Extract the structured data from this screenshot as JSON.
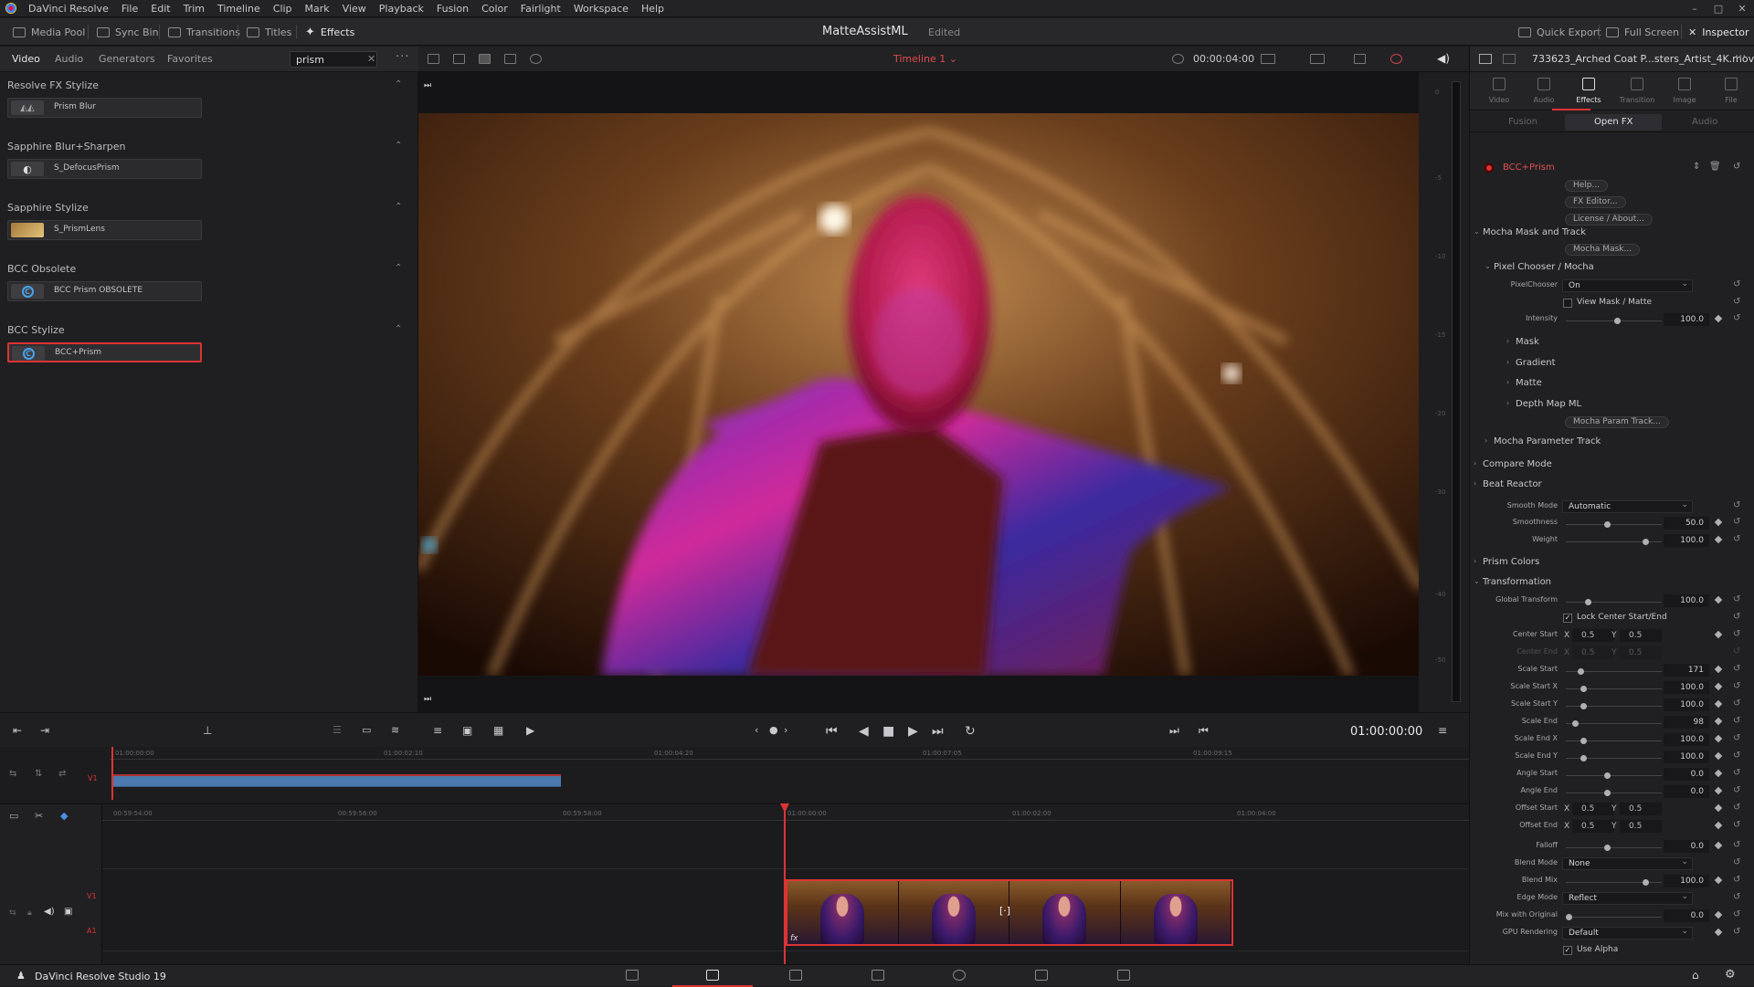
{
  "app": {
    "menu": [
      "DaVinci Resolve",
      "File",
      "Edit",
      "Trim",
      "Timeline",
      "Clip",
      "Mark",
      "View",
      "Playback",
      "Fusion",
      "Color",
      "Fairlight",
      "Workspace",
      "Help"
    ],
    "window_controls": [
      "–",
      "□",
      "✕"
    ],
    "status_name": "DaVinci Resolve Studio 19"
  },
  "toolbar": {
    "media_pool": "Media Pool",
    "sync_bin": "Sync Bin",
    "transitions": "Transitions",
    "titles": "Titles",
    "effects": "Effects",
    "project_title": "MatteAssistML",
    "edited": "Edited",
    "quick_export": "Quick Export",
    "full_screen": "Full Screen",
    "inspector": "Inspector"
  },
  "effects_panel": {
    "tabs": [
      "Video",
      "Audio",
      "Generators",
      "Favorites"
    ],
    "search_value": "prism",
    "groups": [
      {
        "name": "Resolve FX Stylize",
        "item": "Prism Blur"
      },
      {
        "name": "Sapphire Blur+Sharpen",
        "item": "S_DefocusPrism"
      },
      {
        "name": "Sapphire Stylize",
        "item": "S_PrismLens"
      },
      {
        "name": "BCC Obsolete",
        "item": "BCC Prism OBSOLETE"
      },
      {
        "name": "BCC Stylize",
        "item": "BCC+Prism"
      }
    ],
    "bcc_letter": "C"
  },
  "viewer": {
    "timeline_name": "Timeline 1 ⌄",
    "timecode": "00:00:04:00",
    "meter_labels": [
      "0",
      "-5",
      "-10",
      "-15",
      "-20",
      "-30",
      "-40",
      "-50"
    ]
  },
  "transport": {
    "timecode": "01:00:00:00"
  },
  "mini_timeline": {
    "ticks": [
      "01:00:00:00",
      "01:00:02:10",
      "01:00:04:20",
      "01:00:07:05",
      "01:00:09:15"
    ],
    "track": "V1"
  },
  "main_timeline": {
    "ticks": [
      "00:59:54:00",
      "00:59:56:00",
      "00:59:58:00",
      "01:00:00:00",
      "01:00:02:00",
      "01:00:04:00"
    ],
    "tracks": [
      "V1",
      "A1"
    ],
    "fx_badge": "fx",
    "transition_mark": "[·]"
  },
  "inspector": {
    "filename": "733623_Arched Coat P...sters_Artist_4K.mov",
    "tabs": [
      "Video",
      "Audio",
      "Effects",
      "Transition",
      "Image",
      "File"
    ],
    "subtabs": [
      "Fusion",
      "Open FX",
      "Audio"
    ],
    "effect_name": "BCC+Prism",
    "buttons": {
      "help": "Help...",
      "fx_editor": "FX Editor...",
      "license": "License / About...",
      "mocha_mask": "Mocha Mask...",
      "mocha_param": "Mocha Param Track..."
    },
    "sections": {
      "mocha_mask_track": "Mocha Mask and Track",
      "pixel_chooser": "Pixel Chooser / Mocha",
      "mask": "Mask",
      "gradient": "Gradient",
      "matte": "Matte",
      "depth_map": "Depth Map ML",
      "mocha_param_track": "Mocha Parameter Track",
      "compare_mode": "Compare Mode",
      "beat_reactor": "Beat Reactor",
      "prism_colors": "Prism Colors",
      "transformation": "Transformation"
    },
    "params": {
      "pixelchooser": {
        "label": "PixelChooser",
        "value": "On"
      },
      "view_mask": {
        "label": "View Mask / Matte"
      },
      "intensity": {
        "label": "Intensity",
        "value": "100.0",
        "pos": 0.5
      },
      "smooth_mode": {
        "label": "Smooth Mode",
        "value": "Automatic"
      },
      "smoothness": {
        "label": "Smoothness",
        "value": "50.0",
        "pos": 0.4
      },
      "weight": {
        "label": "Weight",
        "value": "100.0",
        "pos": 0.8
      },
      "global_transform": {
        "label": "Global Transform",
        "value": "100.0",
        "pos": 0.2
      },
      "lock_center": {
        "label": "Lock Center Start/End"
      },
      "center_start": {
        "label": "Center Start",
        "x": "0.5",
        "y": "0.5"
      },
      "center_end": {
        "label": "Center End",
        "x": "0.5",
        "y": "0.5"
      },
      "scale_start": {
        "label": "Scale Start",
        "value": "171",
        "pos": 0.12
      },
      "scale_start_x": {
        "label": "Scale Start X",
        "value": "100.0",
        "pos": 0.15
      },
      "scale_start_y": {
        "label": "Scale Start Y",
        "value": "100.0",
        "pos": 0.15
      },
      "scale_end": {
        "label": "Scale End",
        "value": "98",
        "pos": 0.07
      },
      "scale_end_x": {
        "label": "Scale End X",
        "value": "100.0",
        "pos": 0.15
      },
      "scale_end_y": {
        "label": "Scale End Y",
        "value": "100.0",
        "pos": 0.15
      },
      "angle_start": {
        "label": "Angle Start",
        "value": "0.0",
        "pos": 0.4
      },
      "angle_end": {
        "label": "Angle End",
        "value": "0.0",
        "pos": 0.4
      },
      "offset_start": {
        "label": "Offset Start",
        "x": "0.5",
        "y": "0.5"
      },
      "offset_end": {
        "label": "Offset End",
        "x": "0.5",
        "y": "0.5"
      },
      "falloff": {
        "label": "Falloff",
        "value": "0.0",
        "pos": 0.4
      },
      "blend_mode": {
        "label": "Blend Mode",
        "value": "None"
      },
      "blend_mix": {
        "label": "Blend Mix",
        "value": "100.0",
        "pos": 0.8
      },
      "edge_mode": {
        "label": "Edge Mode",
        "value": "Reflect"
      },
      "mix_original": {
        "label": "Mix with Original",
        "value": "0.0",
        "pos": 0.0
      },
      "gpu_rendering": {
        "label": "GPU Rendering",
        "value": "Default"
      },
      "use_alpha": {
        "label": "Use Alpha"
      }
    }
  }
}
